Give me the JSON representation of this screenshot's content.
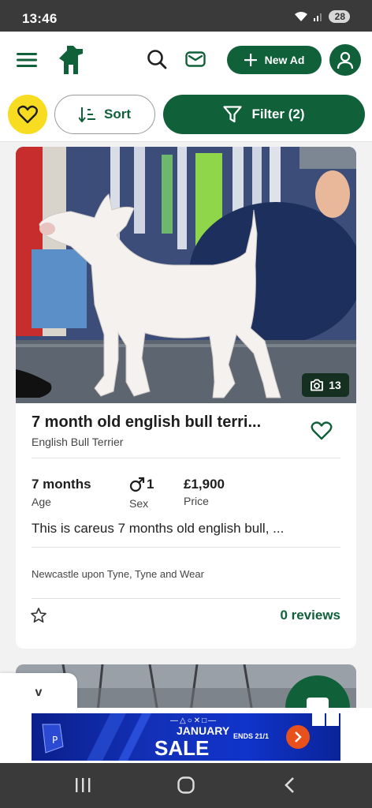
{
  "status_bar": {
    "time": "13:46",
    "battery": "28"
  },
  "header": {
    "menu_icon": "hamburger-menu-icon",
    "logo_icon": "pets4homes-logo",
    "search_icon": "search-icon",
    "messages_icon": "envelope-icon",
    "new_ad_label": "New Ad",
    "account_icon": "user-icon"
  },
  "toolbar": {
    "sort_label": "Sort",
    "filter_label": "Filter (2)"
  },
  "listing": {
    "title": "7 month old english bull terri...",
    "breed": "English Bull Terrier",
    "photo_count": "13",
    "age_value": "7 months",
    "age_label": "Age",
    "sex_value": "1",
    "sex_label": "Sex",
    "price_value": "£1,900",
    "price_label": "Price",
    "description": "This is careus 7 months old english bull, ...",
    "location": "Newcastle upon Tyne, Tyne and Wear",
    "reviews": "0 reviews"
  },
  "collapse_label": "v",
  "ad": {
    "small_text": "—△○✕□—",
    "title_line1": "JANUARY",
    "title_line2": "SALE",
    "ends_text": "ENDS 21/1"
  },
  "colors": {
    "brand_green": "#10603a",
    "favorite_yellow": "#f7dc21"
  }
}
